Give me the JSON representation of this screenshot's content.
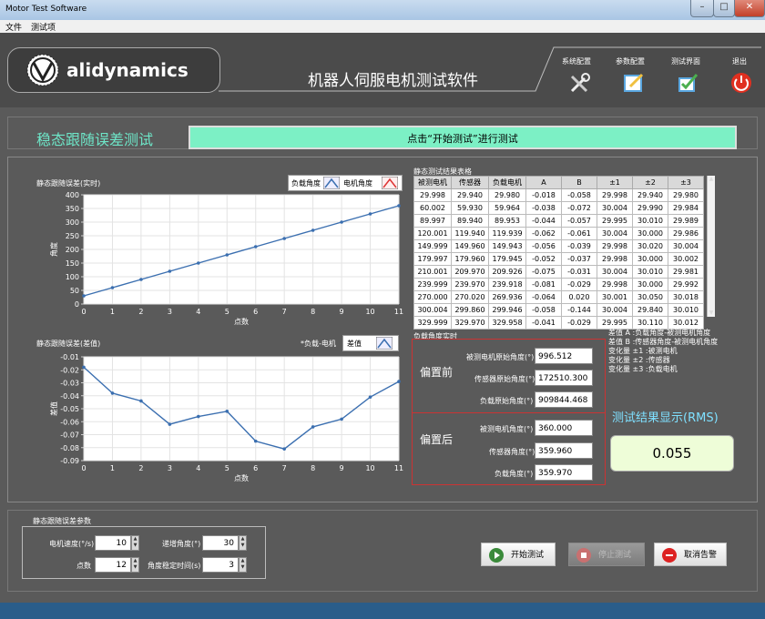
{
  "window": {
    "title": "Motor Test Software"
  },
  "menu": [
    "文件",
    "测试项"
  ],
  "header": {
    "brand": "alidynamics",
    "app_title": "机器人伺服电机测试软件",
    "nav": [
      {
        "label": "系统配置",
        "icon": "tools-icon"
      },
      {
        "label": "参数配置",
        "icon": "edit-icon"
      },
      {
        "label": "测试界面",
        "icon": "check-edit-icon"
      },
      {
        "label": "退出",
        "icon": "power-icon"
      }
    ]
  },
  "page": {
    "title": "稳态跟随误差测试",
    "status": "点击“开始测试”进行测试"
  },
  "chart1_panel": {
    "label": "静态跟随误差(实时)",
    "legend": [
      "负载角度",
      "电机角度"
    ]
  },
  "chart2_panel": {
    "label": "静态跟随误差(差值)",
    "legend_prefix": "*负载-电机",
    "legend": [
      "差值"
    ]
  },
  "chart_data": [
    {
      "type": "line",
      "x": [
        0,
        1,
        2,
        3,
        4,
        5,
        6,
        7,
        8,
        9,
        10,
        11
      ],
      "series": [
        {
          "name": "负载角度",
          "values": [
            30,
            60,
            90,
            120,
            150,
            180,
            210,
            240,
            270,
            300,
            330,
            360
          ]
        }
      ],
      "xlabel": "点数",
      "ylabel": "角度",
      "xlim": [
        0,
        11
      ],
      "ylim": [
        0,
        400
      ],
      "yticks": [
        0,
        50,
        100,
        150,
        200,
        250,
        300,
        350,
        400
      ],
      "grid": true,
      "color": "#3b6fb0"
    },
    {
      "type": "line",
      "x": [
        0,
        1,
        2,
        3,
        4,
        5,
        6,
        7,
        8,
        9,
        10,
        11
      ],
      "series": [
        {
          "name": "差值",
          "values": [
            -0.018,
            -0.038,
            -0.044,
            -0.062,
            -0.056,
            -0.052,
            -0.075,
            -0.081,
            -0.064,
            -0.058,
            -0.041,
            -0.029
          ]
        }
      ],
      "xlabel": "点数",
      "ylabel": "差值",
      "xlim": [
        0,
        11
      ],
      "ylim": [
        -0.09,
        -0.01
      ],
      "yticks": [
        -0.09,
        -0.08,
        -0.07,
        -0.06,
        -0.05,
        -0.04,
        -0.03,
        -0.02,
        -0.01
      ],
      "grid": true,
      "color": "#3b6fb0"
    }
  ],
  "results": {
    "caption": "静态测试结果表格",
    "columns": [
      "被测电机",
      "传感器",
      "负载电机",
      "A",
      "B",
      "±1",
      "±2",
      "±3"
    ],
    "rows": [
      [
        "29.998",
        "29.940",
        "29.980",
        "-0.018",
        "-0.058",
        "29.998",
        "29.940",
        "29.980"
      ],
      [
        "60.002",
        "59.930",
        "59.964",
        "-0.038",
        "-0.072",
        "30.004",
        "29.990",
        "29.984"
      ],
      [
        "89.997",
        "89.940",
        "89.953",
        "-0.044",
        "-0.057",
        "29.995",
        "30.010",
        "29.989"
      ],
      [
        "120.001",
        "119.940",
        "119.939",
        "-0.062",
        "-0.061",
        "30.004",
        "30.000",
        "29.986"
      ],
      [
        "149.999",
        "149.960",
        "149.943",
        "-0.056",
        "-0.039",
        "29.998",
        "30.020",
        "30.004"
      ],
      [
        "179.997",
        "179.960",
        "179.945",
        "-0.052",
        "-0.037",
        "29.998",
        "30.000",
        "30.002"
      ],
      [
        "210.001",
        "209.970",
        "209.926",
        "-0.075",
        "-0.031",
        "30.004",
        "30.010",
        "29.981"
      ],
      [
        "239.999",
        "239.970",
        "239.918",
        "-0.081",
        "-0.029",
        "29.998",
        "30.000",
        "29.992"
      ],
      [
        "270.000",
        "270.020",
        "269.936",
        "-0.064",
        "0.020",
        "30.001",
        "30.050",
        "30.018"
      ],
      [
        "300.004",
        "299.860",
        "299.946",
        "-0.058",
        "-0.144",
        "30.004",
        "29.840",
        "30.010"
      ],
      [
        "329.999",
        "329.970",
        "329.958",
        "-0.041",
        "-0.029",
        "29.995",
        "30.110",
        "30.012"
      ]
    ]
  },
  "angles": {
    "caption": "负载角度实时",
    "before_label": "偏置前",
    "after_label": "偏置后",
    "before": [
      {
        "label": "被测电机原始角度(°)",
        "value": "996.512"
      },
      {
        "label": "传感器原始角度(°)",
        "value": "172510.300"
      },
      {
        "label": "负载原始角度(°)",
        "value": "909844.468"
      }
    ],
    "after": [
      {
        "label": "被测电机角度(°)",
        "value": "360.000"
      },
      {
        "label": "传感器角度(°)",
        "value": "359.960"
      },
      {
        "label": "负载角度(°)",
        "value": "359.970"
      }
    ]
  },
  "notes": [
    "差值 A :负载角度-被测电机角度",
    "差值 B :传感器角度-被测电机角度",
    "变化量 ±1 :被测电机",
    "变化量 ±2 :传感器",
    "变化量 ±3 :负载电机"
  ],
  "rms": {
    "title": "测试结果显示(RMS)",
    "value": "0.055"
  },
  "params": {
    "caption": "静态跟随误差参数",
    "speed_label": "电机速度(°/s)",
    "speed": "10",
    "step_label": "递增角度(°)",
    "step": "30",
    "points_label": "点数",
    "points": "12",
    "settle_label": "角度稳定时间(s)",
    "settle": "3"
  },
  "buttons": {
    "start": "开始测试",
    "stop": "停止测试",
    "cancel": "取消告警"
  },
  "colors": {
    "accent": "#7cf0c5",
    "title_green": "#6ee6c8",
    "rms_blue": "#7fe0ff"
  }
}
